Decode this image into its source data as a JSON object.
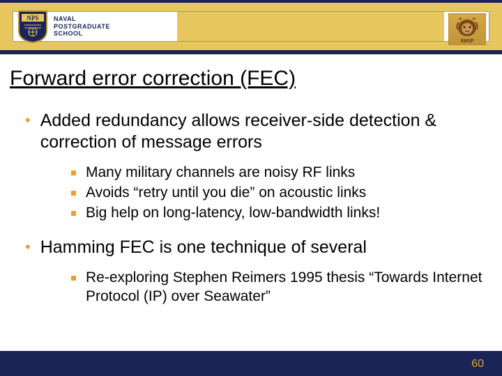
{
  "header": {
    "school_line1": "NAVAL",
    "school_line2": "POSTGRADUATE",
    "school_line3": "SCHOOL",
    "nps_initials": "NPS",
    "right_logo_text": "XMSF"
  },
  "title": "Forward error correction (FEC)",
  "bullets": [
    {
      "text": "Added redundancy allows receiver-side detection & correction of message errors",
      "subs": [
        "Many military channels are noisy RF links",
        "Avoids “retry until you die” on acoustic links",
        "Big help on long-latency, low-bandwidth links!"
      ]
    },
    {
      "text": "Hamming FEC is one technique of several",
      "subs": [
        "Re-exploring Stephen Reimers 1995 thesis “Towards Internet Protocol (IP) over Seawater”"
      ]
    }
  ],
  "page_number": "60",
  "colors": {
    "accent": "#e8a030",
    "band": "#e8c65e",
    "navy": "#1a2456"
  }
}
